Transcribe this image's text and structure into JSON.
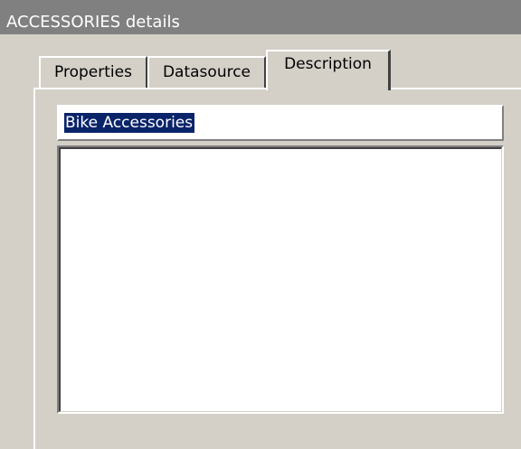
{
  "window": {
    "title": "ACCESSORIES details"
  },
  "tabs": [
    {
      "label": "Properties",
      "active": false
    },
    {
      "label": "Datasource",
      "active": false
    },
    {
      "label": "Description",
      "active": true
    }
  ],
  "description": {
    "title_value": "Bike Accessories",
    "body_value": ""
  }
}
